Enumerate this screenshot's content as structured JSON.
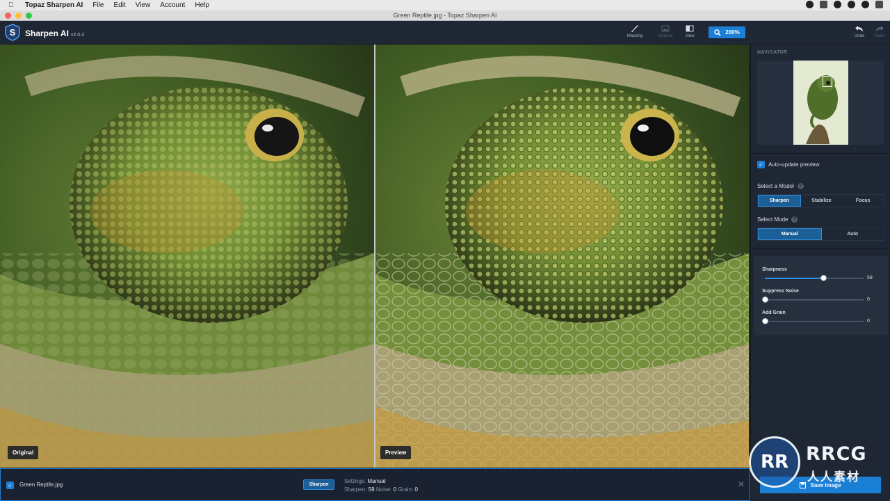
{
  "menubar": {
    "app_name": "Topaz Sharpen AI",
    "items": [
      "File",
      "Edit",
      "View",
      "Account",
      "Help"
    ]
  },
  "window": {
    "title": "Green Reptile.jpg - Topaz Sharpen AI"
  },
  "toolbar": {
    "brand": "Sharpen AI",
    "version": "v2.0.4",
    "tools": [
      {
        "label": "Masking",
        "icon": "brush-icon"
      },
      {
        "label": "Original",
        "icon": "image-icon"
      },
      {
        "label": "View",
        "icon": "split-view-icon"
      }
    ],
    "zoom_label": "200%",
    "undo_label": "Undo",
    "redo_label": "Redo"
  },
  "canvas": {
    "left_label": "Original",
    "right_label": "Preview"
  },
  "side": {
    "navigator_title": "NAVIGATOR",
    "auto_update_label": "Auto-update preview",
    "auto_update_checked": true,
    "model_label": "Select a Model",
    "models": [
      "Sharpen",
      "Stabilize",
      "Focus"
    ],
    "model_selected": "Sharpen",
    "mode_label": "Select Mode",
    "modes": [
      "Manual",
      "Auto"
    ],
    "mode_selected": "Manual",
    "sliders": [
      {
        "label": "Sharpness",
        "value": "59",
        "fraction": 0.59
      },
      {
        "label": "Suppress Noise",
        "value": "0",
        "fraction": 0
      },
      {
        "label": "Add Grain",
        "value": "0",
        "fraction": 0
      }
    ]
  },
  "bottom": {
    "file_name": "Green Reptile.jpg",
    "model_pill": "Sharpen",
    "settings_label": "Settings:",
    "settings_value": "Manual",
    "sharpen_label": "Sharpen:",
    "sharpen_value": "59",
    "noise_label": "Noise:",
    "noise_value": "0",
    "grain_label": "Grain:",
    "grain_value": "0",
    "close_glyph": "✕",
    "save_label": "Save Image"
  },
  "watermark": {
    "logo": "RR",
    "text": "RRCG",
    "sub": "人人素材"
  },
  "colors": {
    "accent": "#1b7fd6",
    "panel": "#1f2634"
  }
}
